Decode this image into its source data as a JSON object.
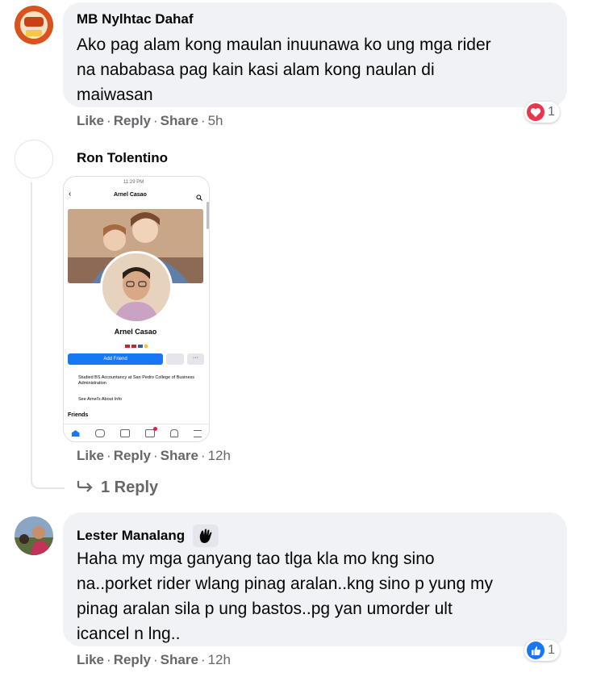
{
  "comments": [
    {
      "author": "MB Nylhtac Dahaf",
      "text_lines": [
        "Ako pag alam kong maulan inuunawa ko ung mga rider",
        "na nababasa pag kain kasi alam kong naulan di",
        "maiwasan"
      ],
      "like": "Like",
      "reply": "Reply",
      "share": "Share",
      "time": "5h",
      "reaction": {
        "type": "love",
        "count": "1"
      }
    },
    {
      "author": "Ron Tolentino",
      "like": "Like",
      "reply": "Reply",
      "share": "Share",
      "time": "12h",
      "replies_link": "1 Reply",
      "screenshot": {
        "status_time": "11:29 PM",
        "profile_name": "Arnel Casao",
        "add_friend": "Add Friend",
        "studied": "Studied BS Accountancy at San Pedro College of Business Administration",
        "about": "See Arnel's About Info",
        "friends_heading": "Friends",
        "nav_labels": [
          "Home",
          "Friends",
          "Watch",
          "Pages",
          "Notifications",
          "Menu"
        ]
      }
    },
    {
      "author": "Lester Manalang",
      "text_lines": [
        "Haha my mga ganyang tao tlga kla mo kng sino",
        "na..porket rider wlang pinag aralan..kng sino p yung my",
        "pinag aralan sila p ung bastos..pg yan umorder ult",
        "icancel n lng.."
      ],
      "like": "Like",
      "reply": "Reply",
      "share": "Share",
      "time": "12h",
      "reaction": {
        "type": "like",
        "count": "1"
      }
    }
  ],
  "colors": {
    "love": "#e8384f",
    "like": "#1877f2",
    "bubble": "#f0f2f5",
    "meta": "#65676b"
  }
}
